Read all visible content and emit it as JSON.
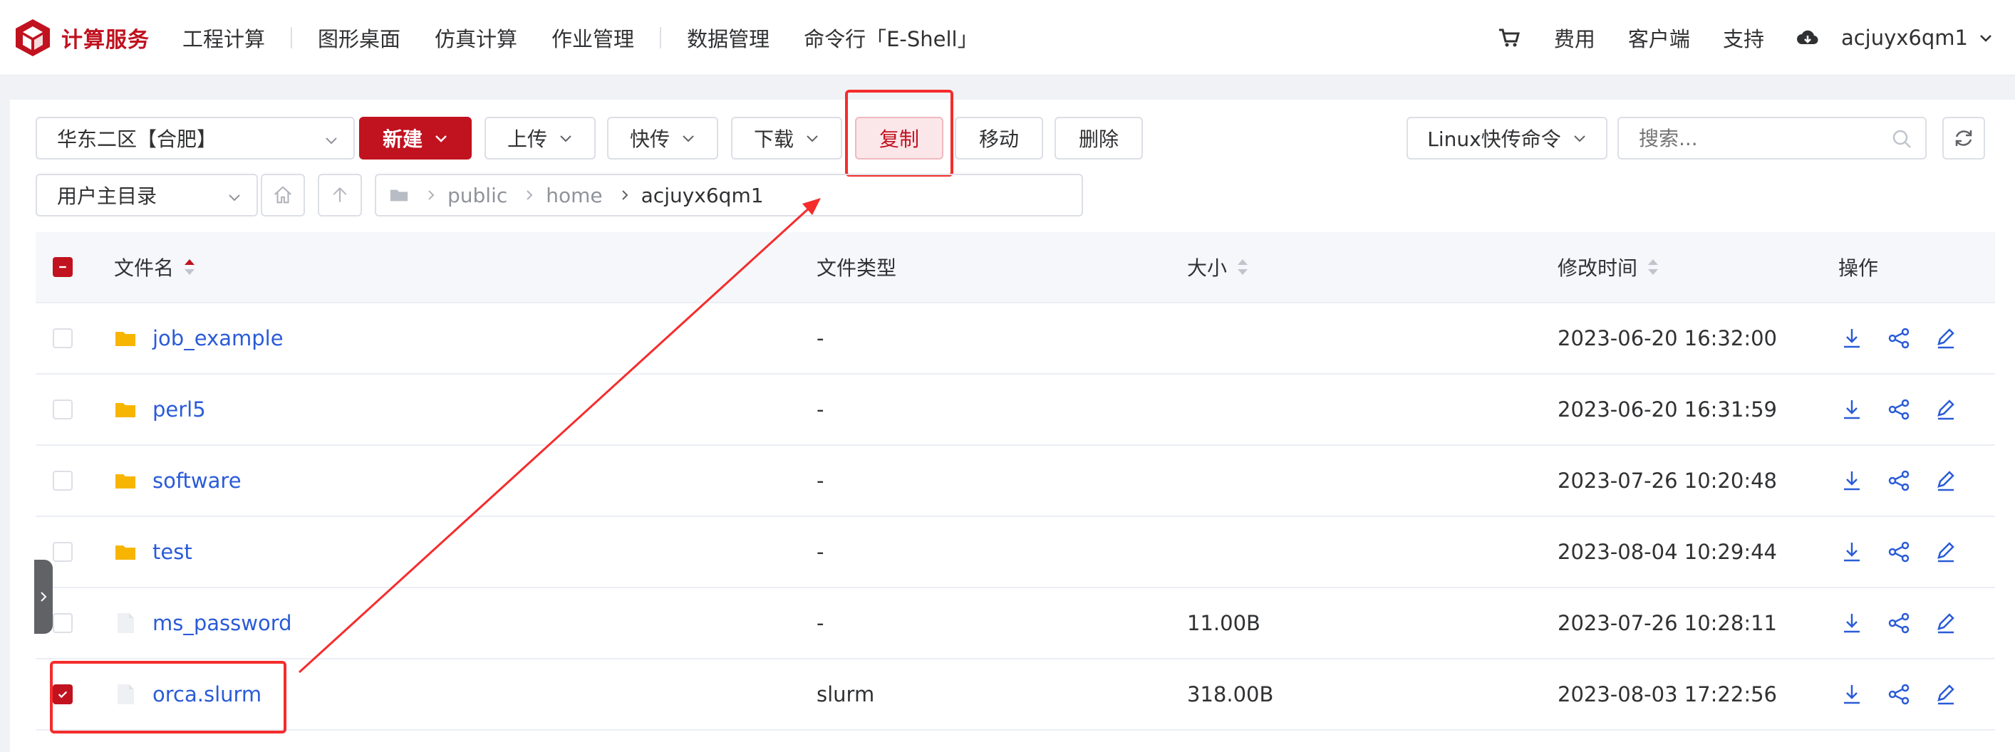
{
  "brand": {
    "name": "计算服务",
    "color": "#c1121f"
  },
  "nav": {
    "items": [
      "工程计算",
      "图形桌面",
      "仿真计算",
      "作业管理",
      "数据管理",
      "命令行「E-Shell」"
    ],
    "right": {
      "fees": "费用",
      "client": "客户端",
      "support": "支持",
      "username": "acjuyx6qm1"
    }
  },
  "toolbar": {
    "region": "华东二区【合肥】",
    "new_label": "新建",
    "upload_label": "上传",
    "fast_upload_label": "快传",
    "download_label": "下载",
    "copy_label": "复制",
    "move_label": "移动",
    "delete_label": "删除",
    "linux_cmd_label": "Linux快传命令",
    "search_placeholder": "搜索..."
  },
  "location": {
    "root_select": "用户主目录",
    "path": [
      "public",
      "home",
      "acjuyx6qm1"
    ]
  },
  "table": {
    "headers": {
      "name": "文件名",
      "type": "文件类型",
      "size": "大小",
      "mtime": "修改时间",
      "ops": "操作"
    },
    "rows": [
      {
        "name": "job_example",
        "kind": "folder",
        "type": "-",
        "size": "",
        "mtime": "2023-06-20 16:32:00",
        "checked": false
      },
      {
        "name": "perl5",
        "kind": "folder",
        "type": "-",
        "size": "",
        "mtime": "2023-06-20 16:31:59",
        "checked": false
      },
      {
        "name": "software",
        "kind": "folder",
        "type": "-",
        "size": "",
        "mtime": "2023-07-26 10:20:48",
        "checked": false
      },
      {
        "name": "test",
        "kind": "folder",
        "type": "-",
        "size": "",
        "mtime": "2023-08-04 10:29:44",
        "checked": false
      },
      {
        "name": "ms_password",
        "kind": "file",
        "type": "-",
        "size": "11.00B",
        "mtime": "2023-07-26 10:28:11",
        "checked": false
      },
      {
        "name": "orca.slurm",
        "kind": "file",
        "type": "slurm",
        "size": "318.00B",
        "mtime": "2023-08-03 17:22:56",
        "checked": true
      }
    ]
  },
  "colors": {
    "accent": "#c1121f",
    "link": "#2a5bd7",
    "folder": "#f7b500",
    "annotation": "#f52c2c"
  },
  "icons": [
    "cart-icon",
    "cloud-icon",
    "home-icon",
    "up-arrow-icon",
    "folder-icon",
    "search-icon",
    "refresh-icon",
    "download-icon",
    "share-icon",
    "edit-icon",
    "file-icon"
  ]
}
